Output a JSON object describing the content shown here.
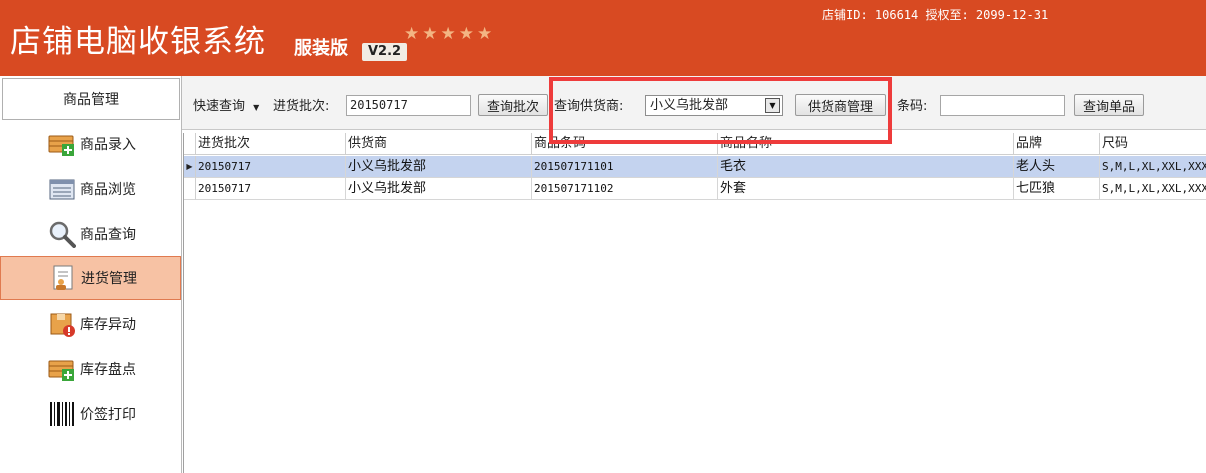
{
  "header": {
    "title": "店铺电脑收银系统",
    "edition": "服装版",
    "version": "V2.2",
    "store_info": "店铺ID: 106614 授权至: 2099-12-31"
  },
  "sidebar": {
    "title": "商品管理",
    "items": [
      {
        "label": "商品录入",
        "icon": "box-add-icon"
      },
      {
        "label": "商品浏览",
        "icon": "list-browse-icon"
      },
      {
        "label": "商品查询",
        "icon": "magnifier-icon"
      },
      {
        "label": "进货管理",
        "icon": "document-user-icon",
        "active": true
      },
      {
        "label": "库存异动",
        "icon": "box-alert-icon"
      },
      {
        "label": "库存盘点",
        "icon": "box-add-icon"
      },
      {
        "label": "价签打印",
        "icon": "barcode-icon"
      }
    ]
  },
  "toolbar": {
    "quick_query": "快速查询",
    "batch_label": "进货批次:",
    "batch_value": "20150717",
    "query_batch_btn": "查询批次",
    "supplier_label": "查询供货商:",
    "supplier_value": "小义乌批发部",
    "supplier_mgmt_btn": "供货商管理",
    "barcode_label": "条码:",
    "barcode_value": "",
    "query_item_btn": "查询单品"
  },
  "grid": {
    "columns": [
      "进货批次",
      "供货商",
      "商品条码",
      "商品名称",
      "品牌",
      "尺码"
    ],
    "rows": [
      [
        "20150717",
        "小义乌批发部",
        "201507171101",
        "毛衣",
        "老人头",
        "S,M,L,XL,XXL,XXX"
      ],
      [
        "20150717",
        "小义乌批发部",
        "201507171102",
        "外套",
        "七匹狼",
        "S,M,L,XL,XXL,XXX"
      ]
    ],
    "selected_row": 0
  },
  "colors": {
    "header_bg": "#d84a22",
    "active_nav_bg": "#f7c2a4",
    "selected_row_bg": "#c4d3ef",
    "highlight_border": "#ee3b3b"
  }
}
